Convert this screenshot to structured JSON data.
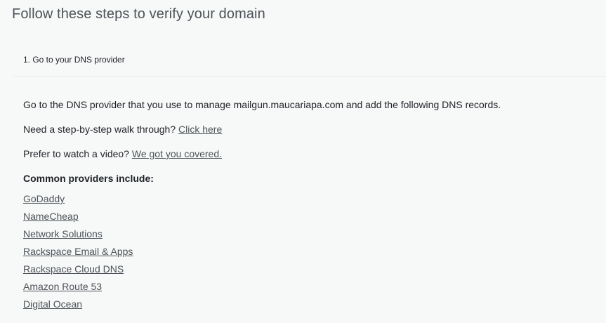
{
  "page": {
    "title": "Follow these steps to verify your domain"
  },
  "step": {
    "header": "1. Go to your DNS provider",
    "intro_text": "Go to the DNS provider that you use to manage mailgun.maucariapa.com and add the following DNS records.",
    "walkthrough_text": "Need a step-by-step walk through? ",
    "walkthrough_link": "Click here",
    "video_text": "Prefer to watch a video? ",
    "video_link": "We got you covered.",
    "providers_heading": "Common providers include:",
    "providers": [
      "GoDaddy",
      "NameCheap",
      "Network Solutions",
      "Rackspace Email & Apps",
      "Rackspace Cloud DNS",
      "Amazon Route 53",
      "Digital Ocean"
    ]
  }
}
